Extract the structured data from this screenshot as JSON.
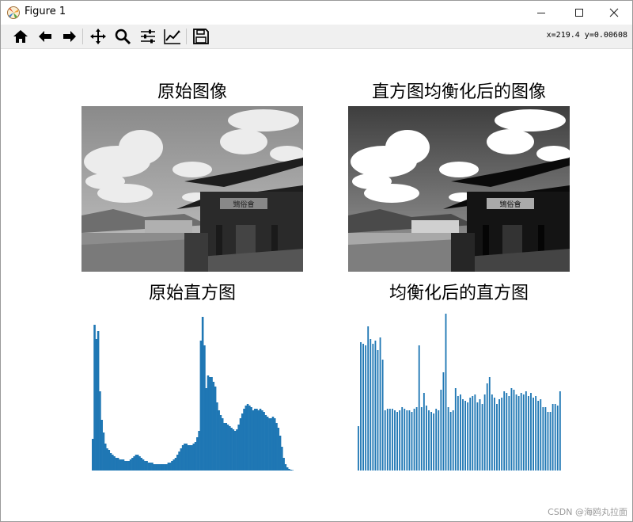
{
  "window": {
    "title": "Figure 1",
    "controls": {
      "minimize": "—",
      "maximize": "☐",
      "close": "✕"
    }
  },
  "toolbar": {
    "buttons": [
      "home-icon",
      "back-icon",
      "forward-icon",
      "pan-icon",
      "zoom-icon",
      "configure-subplots-icon",
      "edit-axes-icon",
      "save-icon"
    ],
    "coords_readout": "x=219.4  y=0.00608"
  },
  "subplots": {
    "original_image_title": "原始图像",
    "equalized_image_title": "直方图均衡化后的图像",
    "original_hist_title": "原始直方图",
    "equalized_hist_title": "均衡化后的直方图"
  },
  "colors": {
    "bar": "#1f77b4",
    "sky": "#bdbdbd",
    "cloud": "#f2f2f2",
    "building": "#262626"
  },
  "chart_data": [
    {
      "type": "bar",
      "title": "原始直方图",
      "xlabel": "",
      "ylabel": "",
      "axes_visible": false,
      "values": [
        0.2,
        0.92,
        0.83,
        0.88,
        0.5,
        0.32,
        0.24,
        0.17,
        0.14,
        0.13,
        0.11,
        0.1,
        0.09,
        0.08,
        0.08,
        0.07,
        0.07,
        0.07,
        0.06,
        0.06,
        0.06,
        0.07,
        0.08,
        0.09,
        0.1,
        0.1,
        0.09,
        0.08,
        0.07,
        0.06,
        0.06,
        0.05,
        0.05,
        0.05,
        0.04,
        0.04,
        0.04,
        0.04,
        0.04,
        0.04,
        0.04,
        0.04,
        0.05,
        0.05,
        0.06,
        0.07,
        0.08,
        0.1,
        0.12,
        0.14,
        0.16,
        0.17,
        0.17,
        0.16,
        0.16,
        0.16,
        0.17,
        0.18,
        0.21,
        0.25,
        0.82,
        0.97,
        0.79,
        0.52,
        0.6,
        0.59,
        0.59,
        0.56,
        0.53,
        0.43,
        0.38,
        0.35,
        0.33,
        0.3,
        0.3,
        0.29,
        0.28,
        0.27,
        0.26,
        0.25,
        0.26,
        0.29,
        0.33,
        0.36,
        0.39,
        0.41,
        0.42,
        0.41,
        0.4,
        0.38,
        0.39,
        0.39,
        0.38,
        0.39,
        0.38,
        0.37,
        0.35,
        0.34,
        0.33,
        0.33,
        0.34,
        0.33,
        0.3,
        0.27,
        0.22,
        0.15,
        0.08,
        0.04,
        0.02,
        0.01,
        0.005,
        0.003
      ],
      "ylim": [
        0,
        1
      ]
    },
    {
      "type": "bar",
      "title": "均衡化后的直方图",
      "xlabel": "",
      "ylabel": "",
      "axes_visible": false,
      "values": [
        0.28,
        0.81,
        0.8,
        0.79,
        0.91,
        0.83,
        0.8,
        0.82,
        0.76,
        0.84,
        0.7,
        0.38,
        0.39,
        0.39,
        0.39,
        0.38,
        0.37,
        0.38,
        0.4,
        0.39,
        0.38,
        0.38,
        0.37,
        0.39,
        0.4,
        0.79,
        0.4,
        0.49,
        0.41,
        0.38,
        0.37,
        0.36,
        0.39,
        0.38,
        0.51,
        0.62,
        0.99,
        0.4,
        0.37,
        0.38,
        0.52,
        0.47,
        0.48,
        0.45,
        0.44,
        0.43,
        0.46,
        0.47,
        0.48,
        0.43,
        0.45,
        0.42,
        0.48,
        0.55,
        0.59,
        0.48,
        0.46,
        0.42,
        0.45,
        0.46,
        0.5,
        0.49,
        0.47,
        0.52,
        0.51,
        0.48,
        0.47,
        0.49,
        0.48,
        0.5,
        0.47,
        0.49,
        0.46,
        0.47,
        0.44,
        0.45,
        0.4,
        0.4,
        0.37,
        0.37,
        0.42,
        0.42,
        0.41,
        0.5
      ],
      "ylim": [
        0,
        1
      ]
    }
  ]
}
